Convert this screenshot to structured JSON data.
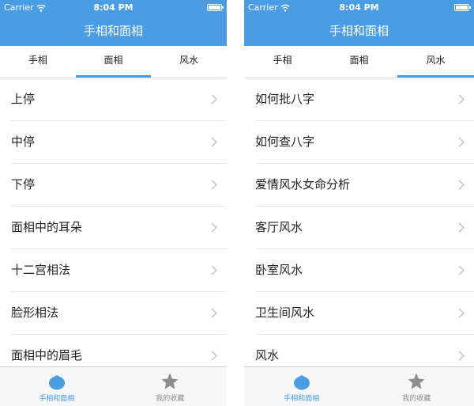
{
  "colors": {
    "brand_blue": "#4a9de3",
    "tabbar_bg": "#f7f7f7",
    "inactive_gray": "#8e8e8e"
  },
  "screens": [
    {
      "status": {
        "carrier": "Carrier",
        "time": "8:04 PM"
      },
      "nav_title": "手相和面相",
      "tabs": [
        {
          "label": "手相"
        },
        {
          "label": "面相"
        },
        {
          "label": "风水"
        }
      ],
      "active_tab": "面相",
      "items": [
        {
          "label": "上停"
        },
        {
          "label": "中停"
        },
        {
          "label": "下停"
        },
        {
          "label": "面相中的耳朵"
        },
        {
          "label": "十二宫相法"
        },
        {
          "label": "脸形相法"
        },
        {
          "label": "面相中的眉毛"
        }
      ],
      "tabbar": [
        {
          "label": "手相和面相",
          "icon": "fruit-icon"
        },
        {
          "label": "我的收藏",
          "icon": "star-icon"
        }
      ]
    },
    {
      "status": {
        "carrier": "Carrier",
        "time": "8:04 PM"
      },
      "nav_title": "手相和面相",
      "tabs": [
        {
          "label": "手相"
        },
        {
          "label": "面相"
        },
        {
          "label": "风水"
        }
      ],
      "active_tab": "风水",
      "items": [
        {
          "label": "如何批八字"
        },
        {
          "label": "如何查八字"
        },
        {
          "label": "爱情风水女命分析"
        },
        {
          "label": "客厅风水"
        },
        {
          "label": "卧室风水"
        },
        {
          "label": "卫生间风水"
        },
        {
          "label": "风水"
        }
      ],
      "tabbar": [
        {
          "label": "手相和面相",
          "icon": "fruit-icon"
        },
        {
          "label": "我的收藏",
          "icon": "star-icon"
        }
      ]
    }
  ]
}
